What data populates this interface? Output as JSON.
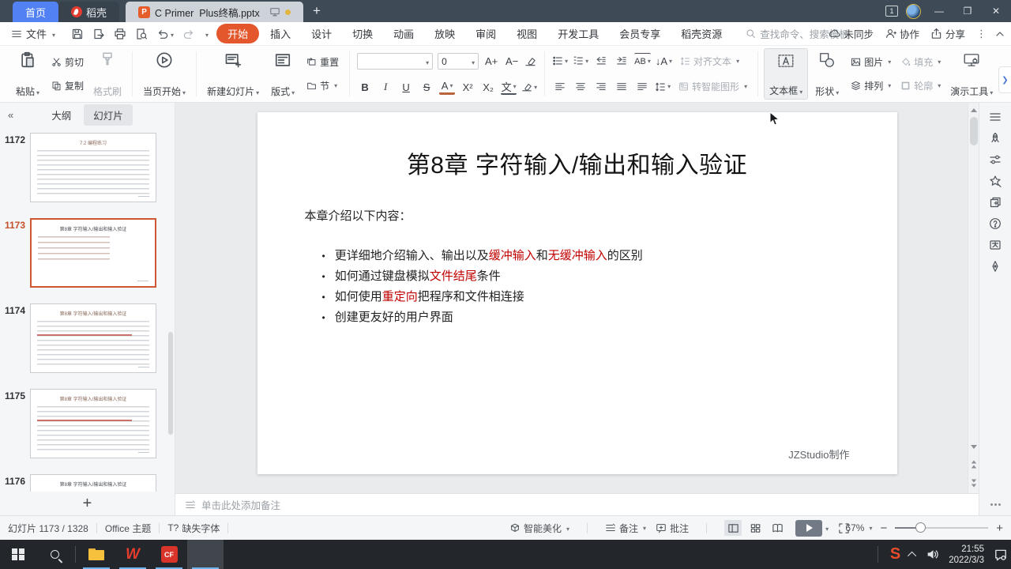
{
  "colors": {
    "accent_orange": "#e4572c",
    "selected_border": "#cd5732",
    "slide_red": "#c00000",
    "home_tab_blue": "#5181f2"
  },
  "titlebar": {
    "home_tab": "首页",
    "docer_tab": "稻壳",
    "document_tab": "C Primer  Plus终稿.pptx",
    "window_badge": "1",
    "minimize": "—",
    "restore": "❐",
    "close": "✕",
    "new_tab": "+"
  },
  "menubar": {
    "file": "文件",
    "tabs": [
      "开始",
      "插入",
      "设计",
      "切换",
      "动画",
      "放映",
      "审阅",
      "视图",
      "开发工具",
      "会员专享",
      "稻壳资源"
    ],
    "search": "查找命令、搜索模板",
    "sync": "未同步",
    "collaborate": "协作",
    "share": "分享"
  },
  "ribbon": {
    "paste": "粘贴",
    "cut": "剪切",
    "copy": "复制",
    "format_painter": "格式刷",
    "play_current": "当页开始",
    "new_slide": "新建幻灯片",
    "layout": "版式",
    "reset": "重置",
    "section": "节",
    "font_size": "0",
    "bold": "B",
    "italic": "I",
    "underline": "U",
    "strike": "S",
    "font_color": "A",
    "superscript": "X²",
    "subscript": "X₂",
    "pinyin": "文",
    "font_grow": "A+",
    "font_shrink": "A−",
    "char_spacing": "AB",
    "text_direction": "A",
    "align_text": "对齐文本",
    "to_smart_graphic": "转智能图形",
    "text_box": "文本框",
    "shapes": "形状",
    "picture": "图片",
    "fill": "填充",
    "arrange": "排列",
    "outline": "轮廓",
    "present_tools": "演示工具",
    "expand": "❯"
  },
  "sidebar": {
    "collapse": "«",
    "outline_tab": "大纲",
    "slides_tab": "幻灯片",
    "add_slide": "+",
    "thumbs": [
      {
        "num": "1172",
        "title": "7.2 编程练习",
        "selected": false,
        "variant": "dense",
        "red": false
      },
      {
        "num": "1173",
        "title": "第8章 字符输入/输出和输入验证",
        "selected": true,
        "variant": "list",
        "red": false
      },
      {
        "num": "1174",
        "title": "第8章 字符输入/输出和输入验证",
        "selected": false,
        "variant": "dense",
        "red": true
      },
      {
        "num": "1175",
        "title": "第8章 字符输入/输出和输入验证",
        "selected": false,
        "variant": "dense",
        "red": true
      },
      {
        "num": "1176",
        "title": "第8章 字符输入/输出和输入验证",
        "selected": false,
        "variant": "title",
        "red": false
      }
    ]
  },
  "slide": {
    "title": "第8章 字符输入/输出和输入验证",
    "intro": "本章介绍以下内容：",
    "bullets": [
      {
        "parts": [
          {
            "text": "更详细地介绍输入、输出以及",
            "red": false
          },
          {
            "text": "缓冲输入",
            "red": true
          },
          {
            "text": "和",
            "red": false
          },
          {
            "text": "无缓冲输入",
            "red": true
          },
          {
            "text": "的区别",
            "red": false
          }
        ]
      },
      {
        "parts": [
          {
            "text": "如何通过键盘模拟",
            "red": false
          },
          {
            "text": "文件结尾",
            "red": true
          },
          {
            "text": "条件",
            "red": false
          }
        ]
      },
      {
        "parts": [
          {
            "text": "如何使用",
            "red": false
          },
          {
            "text": "重定向",
            "red": true
          },
          {
            "text": "把程序和文件相连接",
            "red": false
          }
        ]
      },
      {
        "parts": [
          {
            "text": "创建更友好的用户界面",
            "red": false
          }
        ]
      }
    ],
    "credit": "JZStudio制作"
  },
  "notes": {
    "placeholder": "单击此处添加备注"
  },
  "statusbar": {
    "slide_counter": "幻灯片 1173 / 1328",
    "theme": "Office 主题",
    "missing_font_icon": "T?",
    "missing_font": "缺失字体",
    "smart_beautify": "智能美化",
    "note": "备注",
    "comment": "批注",
    "zoom_level": "67%"
  },
  "taskbar": {
    "time": "21:55",
    "date": "2022/3/3",
    "wps_logo": "W",
    "cf_logo": "CF",
    "sogou_logo": "S"
  }
}
